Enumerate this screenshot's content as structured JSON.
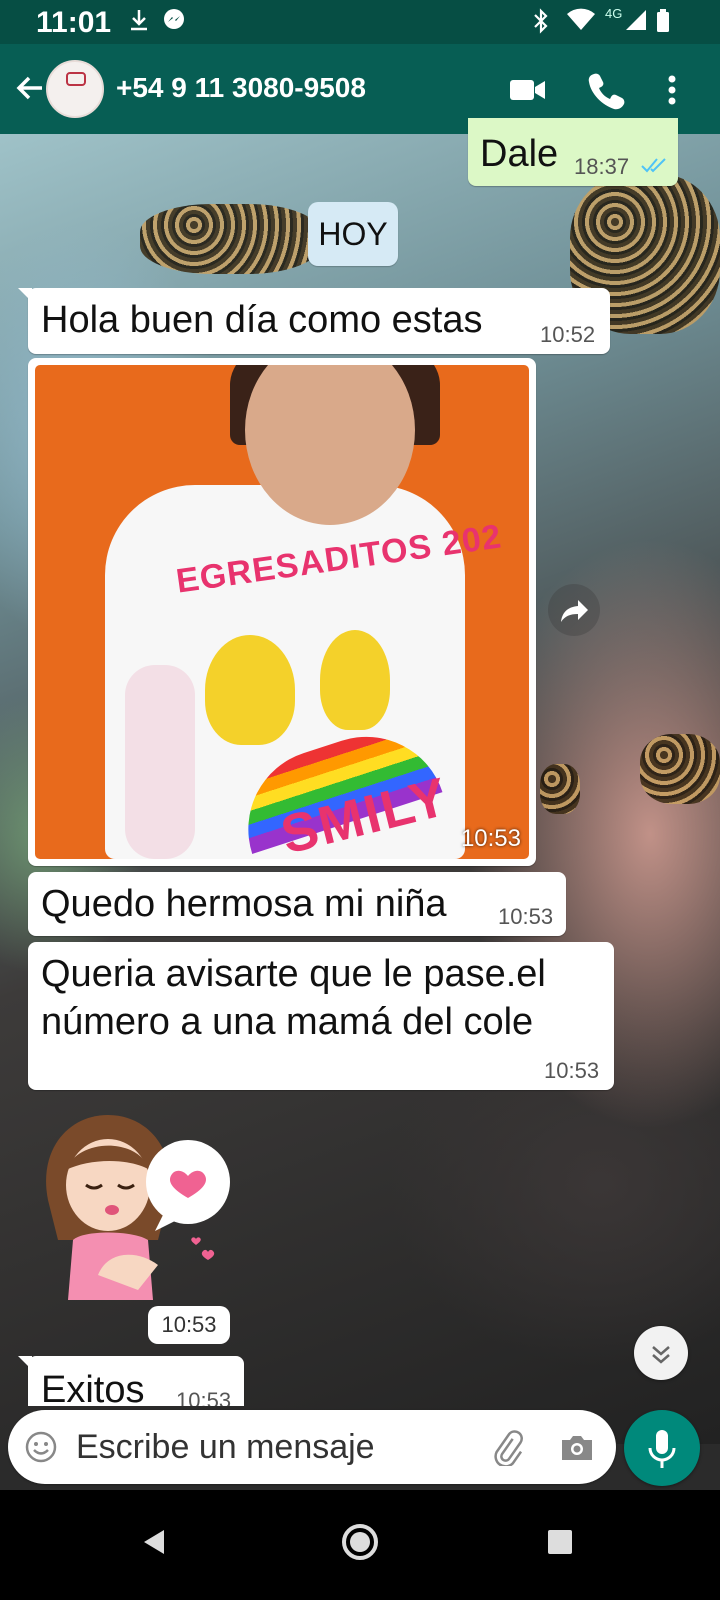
{
  "status_bar": {
    "time": "11:01",
    "network": "4G",
    "icons": [
      "download-icon",
      "messenger-icon",
      "bluetooth-icon",
      "wifi-icon",
      "signal-icon",
      "battery-icon"
    ]
  },
  "header": {
    "contact_name": "+54 9 11 3080-9508",
    "avatar_icon": "contact-avatar",
    "actions": [
      "video-call-icon",
      "phone-icon",
      "more-vert-icon"
    ]
  },
  "messages": {
    "prev_out": {
      "text": "Dale",
      "time": "18:37"
    },
    "date_chip": "HOY",
    "m1": {
      "text": "Hola buen día como estas",
      "time": "10:52"
    },
    "photo": {
      "time": "10:53",
      "shirt_text": "EGRESADITOS 202",
      "shirt_name": "SMILY"
    },
    "m2": {
      "text": "Quedo hermosa mi niña",
      "time": "10:53"
    },
    "m3": {
      "line1": "Queria avisarte que le pase.el",
      "line2": "número a una mamá del cole",
      "time": "10:53"
    },
    "sticker": {
      "time": "10:53"
    },
    "m4": {
      "text": "Exitos",
      "time": "10:53"
    }
  },
  "compose": {
    "placeholder": "Escribe un mensaje",
    "icons": [
      "emoji-icon",
      "attach-icon",
      "camera-icon",
      "mic-icon"
    ]
  },
  "nav": {
    "icons": [
      "back-nav-icon",
      "home-nav-icon",
      "recents-nav-icon"
    ]
  },
  "colors": {
    "header": "#075e54",
    "status_bar": "#064e44",
    "outgoing_bubble": "#dcf8c6",
    "mic_button": "#00897b",
    "read_ticks": "#4fc3f7"
  }
}
